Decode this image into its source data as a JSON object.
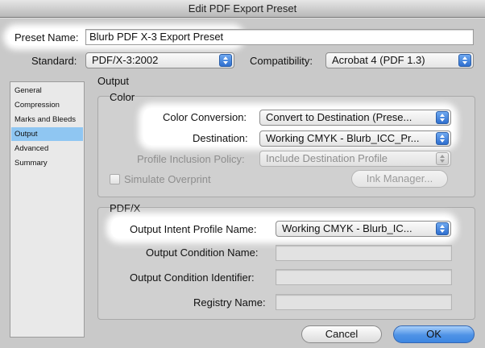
{
  "window": {
    "title": "Edit PDF Export Preset"
  },
  "preset": {
    "label": "Preset Name:",
    "value": "Blurb PDF X-3 Export Preset"
  },
  "standard": {
    "label": "Standard:",
    "value": "PDF/X-3:2002"
  },
  "compatibility": {
    "label": "Compatibility:",
    "value": "Acrobat 4 (PDF 1.3)"
  },
  "sidebar": {
    "items": [
      {
        "label": "General"
      },
      {
        "label": "Compression"
      },
      {
        "label": "Marks and Bleeds"
      },
      {
        "label": "Output",
        "selected": true
      },
      {
        "label": "Advanced"
      },
      {
        "label": "Summary"
      }
    ]
  },
  "main": {
    "section_title": "Output",
    "color": {
      "title": "Color",
      "conversion_label": "Color Conversion:",
      "conversion_value": "Convert to Destination (Prese...",
      "destination_label": "Destination:",
      "destination_value": "Working CMYK - Blurb_ICC_Pr...",
      "policy_label": "Profile Inclusion Policy:",
      "policy_value": "Include Destination Profile",
      "simulate_label": "Simulate Overprint",
      "ink_manager_label": "Ink Manager..."
    },
    "pdfx": {
      "title": "PDF/X",
      "intent_label": "Output Intent Profile Name:",
      "intent_value": "Working CMYK - Blurb_IC...",
      "condition_name_label": "Output Condition Name:",
      "condition_name_value": "",
      "condition_id_label": "Output Condition Identifier:",
      "condition_id_value": "",
      "registry_label": "Registry Name:",
      "registry_value": ""
    }
  },
  "buttons": {
    "cancel": "Cancel",
    "ok": "OK"
  },
  "colors": {
    "highlight": "#ffffff",
    "selection": "#8fc6f2",
    "accent": "#3d86e1"
  }
}
